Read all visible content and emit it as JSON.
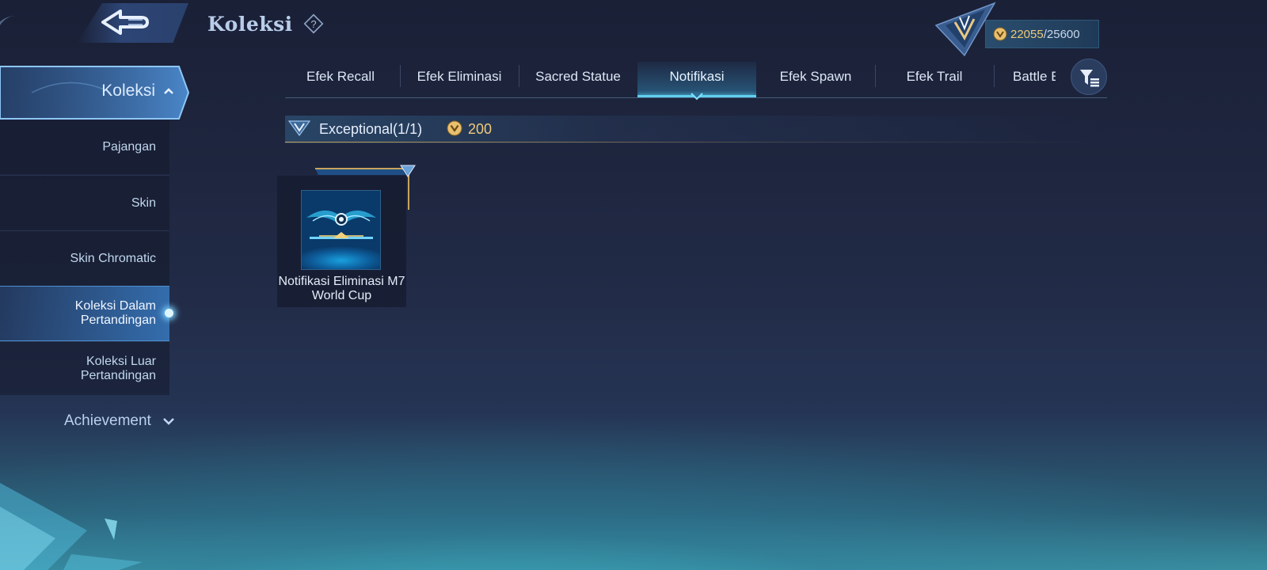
{
  "header": {
    "title": "Koleksi",
    "currency": {
      "current": "22055",
      "separator": "/",
      "max": "25600"
    }
  },
  "sidebar": {
    "active_label": "Koleksi",
    "items": [
      {
        "label": "Pajangan"
      },
      {
        "label": "Skin"
      },
      {
        "label": "Skin Chromatic"
      },
      {
        "label": "Koleksi Dalam Pertandingan",
        "active": true
      },
      {
        "label": "Koleksi Luar Pertandingan"
      }
    ],
    "achievement_label": "Achievement"
  },
  "tabs": [
    {
      "label": "Efek Recall"
    },
    {
      "label": "Efek Eliminasi"
    },
    {
      "label": "Sacred Statue"
    },
    {
      "label": "Notifikasi",
      "active": true
    },
    {
      "label": "Efek Spawn"
    },
    {
      "label": "Efek Trail"
    },
    {
      "label": "Battle E"
    }
  ],
  "section": {
    "title": "Exceptional(1/1)",
    "cost": "200"
  },
  "items": [
    {
      "name": "Notifikasi Eliminasi M7 World Cup"
    }
  ],
  "colors": {
    "accent_cyan": "#5fd0ee",
    "gold": "#f0c97a",
    "text_light": "#dbe7f6"
  },
  "icons": {
    "back": "back-arrow-icon",
    "help": "question-diamond-icon",
    "coin": "coin-icon",
    "filter": "filter-icon",
    "rank": "rank-emblem-icon"
  }
}
